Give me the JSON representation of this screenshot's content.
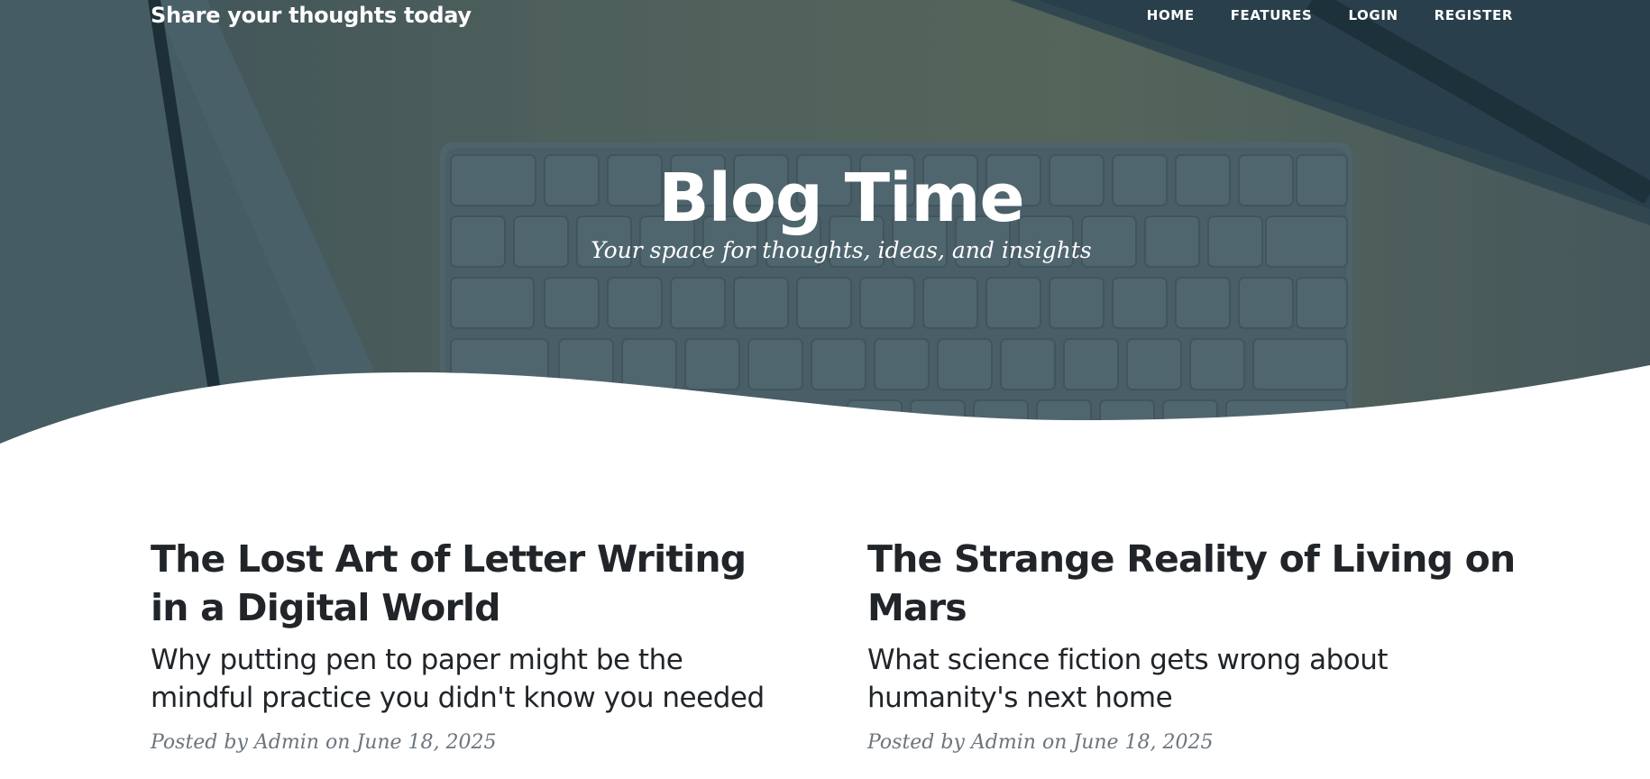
{
  "navbar": {
    "brand": "Share your thoughts today",
    "links": [
      "HOME",
      "FEATURES",
      "LOGIN",
      "REGISTER"
    ]
  },
  "header": {
    "title": "Blog Time",
    "subtitle": "Your space for thoughts, ideas, and insights"
  },
  "posts": [
    {
      "title": "The Lost Art of Letter Writing in a Digital World",
      "subtitle": "Why putting pen to paper might be the mindful practice you didn't know you needed",
      "meta_prefix": "Posted by",
      "author": "Admin",
      "meta_on": "on",
      "date": "June 18, 2025"
    },
    {
      "title": "The Strange Reality of Living on Mars",
      "subtitle": "What science fiction gets wrong about humanity's next home",
      "meta_prefix": "Posted by",
      "author": "Admin",
      "meta_on": "on",
      "date": "June 18, 2025"
    }
  ],
  "colors": {
    "heading_text": "#212529",
    "meta_text": "#6c757d",
    "hero_overlay": "#2e4550",
    "white": "#ffffff"
  },
  "icons": {
    "hero_background": "desk-keyboard-notebook-image"
  }
}
